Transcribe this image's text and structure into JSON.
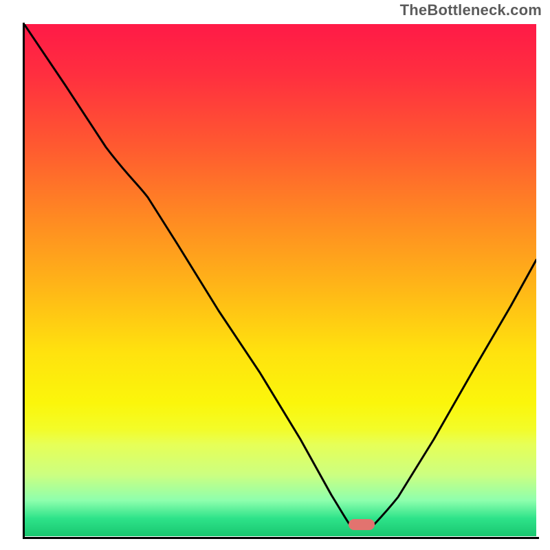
{
  "watermark": "TheBottleneck.com",
  "colors": {
    "curve": "#000000",
    "marker": "#e2736f",
    "axis": "#000000"
  },
  "marker": {
    "x_frac": 0.66,
    "y_frac": 0.977
  },
  "chart_data": {
    "type": "line",
    "title": "",
    "xlabel": "",
    "ylabel": "",
    "xlim": [
      0,
      1
    ],
    "ylim": [
      0,
      1
    ],
    "series": [
      {
        "name": "bottleneck-curve",
        "x": [
          0.0,
          0.08,
          0.16,
          0.22,
          0.3,
          0.38,
          0.46,
          0.54,
          0.6,
          0.635,
          0.685,
          0.73,
          0.8,
          0.88,
          0.95,
          1.0
        ],
        "y": [
          1.0,
          0.88,
          0.76,
          0.69,
          0.57,
          0.44,
          0.32,
          0.19,
          0.08,
          0.024,
          0.024,
          0.07,
          0.19,
          0.33,
          0.45,
          0.54
        ]
      }
    ],
    "annotations": [
      {
        "kind": "marker",
        "x": 0.66,
        "y": 0.023
      }
    ],
    "background_gradient": [
      "#ff1a47",
      "#ff8a22",
      "#ffe20e",
      "#f3fc28",
      "#8effad",
      "#19c66f"
    ]
  }
}
